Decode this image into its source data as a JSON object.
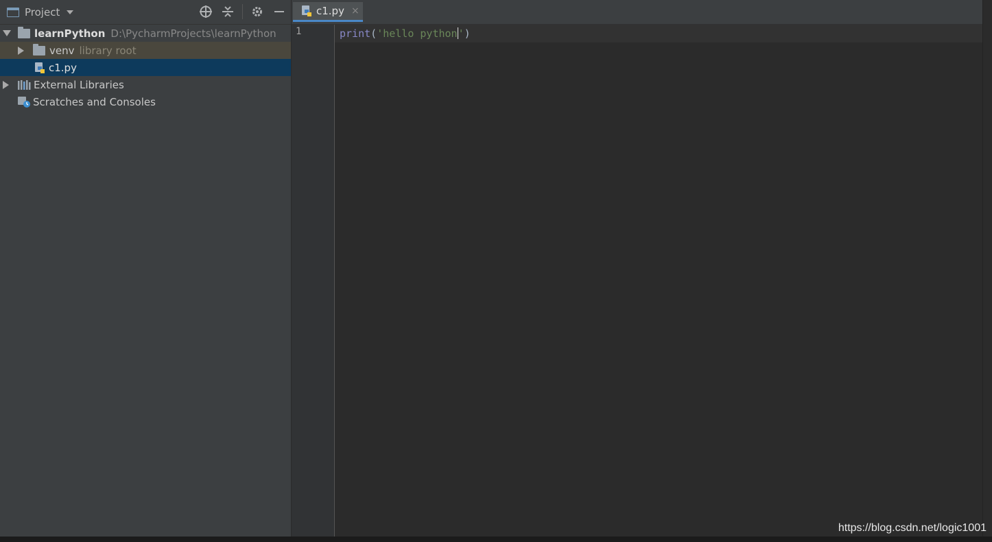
{
  "project_panel": {
    "title": "Project",
    "tree": [
      {
        "name": "learnPython",
        "path": "D:\\PycharmProjects\\learnPython"
      },
      {
        "name": "venv",
        "hint": "library root"
      },
      {
        "name": "c1.py"
      },
      {
        "name": "External Libraries"
      },
      {
        "name": "Scratches and Consoles"
      }
    ]
  },
  "editor": {
    "tab_label": "c1.py",
    "tab_close": "×",
    "line_number": "1",
    "code": {
      "func": "print",
      "open_paren": "(",
      "string": "'hello python",
      "string_end": "'",
      "close_paren": ")"
    }
  },
  "watermark": "https://blog.csdn.net/logic1001",
  "colors": {
    "selection": "#0d3a5c",
    "tab_underline": "#4a88c7",
    "string": "#6a8759",
    "builtin": "#8888c6"
  }
}
